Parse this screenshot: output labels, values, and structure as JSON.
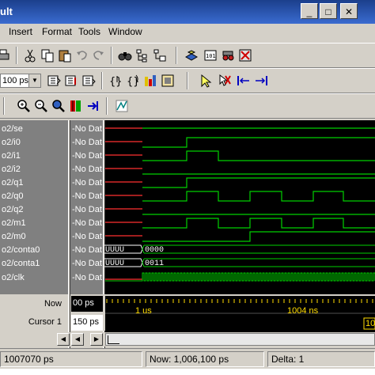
{
  "window": {
    "title": "ult"
  },
  "menu": {
    "items": [
      "Insert",
      "Format",
      "Tools",
      "Window"
    ]
  },
  "toolbar": {
    "time_unit": "100 ps"
  },
  "signals": [
    {
      "name": "o2/se",
      "value": "-No Dat"
    },
    {
      "name": "o2/i0",
      "value": "-No Dat"
    },
    {
      "name": "o2/i1",
      "value": "-No Dat"
    },
    {
      "name": "o2/i2",
      "value": "-No Dat"
    },
    {
      "name": "o2/q1",
      "value": "-No Dat"
    },
    {
      "name": "o2/q0",
      "value": "-No Dat"
    },
    {
      "name": "o2/q2",
      "value": "-No Dat"
    },
    {
      "name": "o2/m1",
      "value": "-No Dat"
    },
    {
      "name": "o2/m0",
      "value": "-No Dat"
    },
    {
      "name": "o2/conta0",
      "value": "-No Dat"
    },
    {
      "name": "o2/conta1",
      "value": "-No Dat"
    },
    {
      "name": "o2/clk",
      "value": "-No Dat"
    }
  ],
  "bus_values": {
    "conta0_initial": "UUUU",
    "conta0_value": "0000",
    "conta1_initial": "UUUU",
    "conta1_value": "0011"
  },
  "cursor_panel": {
    "now_label": "Now",
    "now_value": "00 ps",
    "cursor_label": "Cursor 1",
    "cursor_value": "150 ps"
  },
  "timeline": {
    "mark1": "1 us",
    "mark2": "1004 ns",
    "cursor_tag": "10"
  },
  "statusbar": {
    "left": "1007070 ps",
    "now": "Now: 1,006,100 ps",
    "delta": "Delta: 1"
  },
  "colors": {
    "wave_green": "#00d000",
    "uninit_red": "#ff3030",
    "timeline_yellow": "#ffdc00"
  }
}
